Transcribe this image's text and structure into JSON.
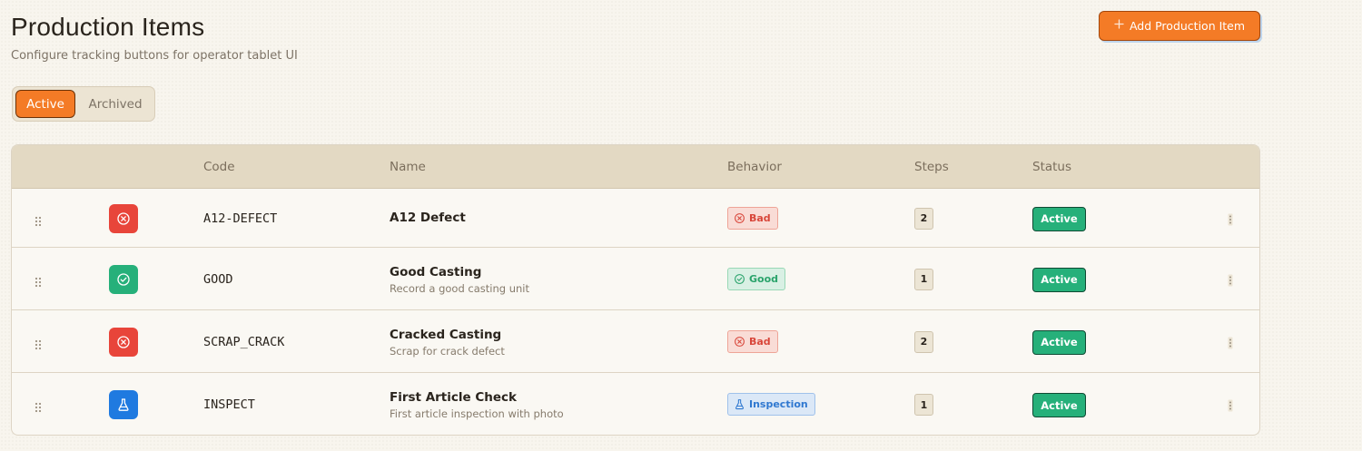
{
  "header": {
    "title": "Production Items",
    "subtitle": "Configure tracking buttons for operator tablet UI",
    "add_button_label": "Add Production Item",
    "add_button_icon": "plus-icon"
  },
  "tabs": [
    {
      "label": "Active",
      "selected": true
    },
    {
      "label": "Archived",
      "selected": false
    }
  ],
  "table": {
    "columns": [
      "",
      "",
      "Code",
      "Name",
      "Behavior",
      "Steps",
      "Status",
      ""
    ],
    "rows": [
      {
        "icon": "x-circle-icon",
        "icon_color": "#e8453a",
        "code": "A12-DEFECT",
        "name": "A12 Defect",
        "description": "",
        "behavior": "Bad",
        "behavior_icon": "x-circle-icon",
        "behavior_kind": "bad",
        "steps": "2",
        "status": "Active"
      },
      {
        "icon": "check-circle-icon",
        "icon_color": "#26b07a",
        "code": "GOOD",
        "name": "Good Casting",
        "description": "Record a good casting unit",
        "behavior": "Good",
        "behavior_icon": "check-circle-icon",
        "behavior_kind": "good",
        "steps": "1",
        "status": "Active"
      },
      {
        "icon": "x-circle-icon",
        "icon_color": "#e8453a",
        "code": "SCRAP_CRACK",
        "name": "Cracked Casting",
        "description": "Scrap for crack defect",
        "behavior": "Bad",
        "behavior_icon": "x-circle-icon",
        "behavior_kind": "bad",
        "steps": "2",
        "status": "Active"
      },
      {
        "icon": "flask-icon",
        "icon_color": "#1f7ae0",
        "code": "INSPECT",
        "name": "First Article Check",
        "description": "First article inspection with photo",
        "behavior": "Inspection",
        "behavior_icon": "flask-icon",
        "behavior_kind": "inspection",
        "steps": "1",
        "status": "Active"
      }
    ]
  },
  "colors": {
    "accent": "#f47b26",
    "status_active": "#26b07a",
    "bad": "#e8453a",
    "good": "#26b07a",
    "inspection": "#1f7ae0"
  }
}
